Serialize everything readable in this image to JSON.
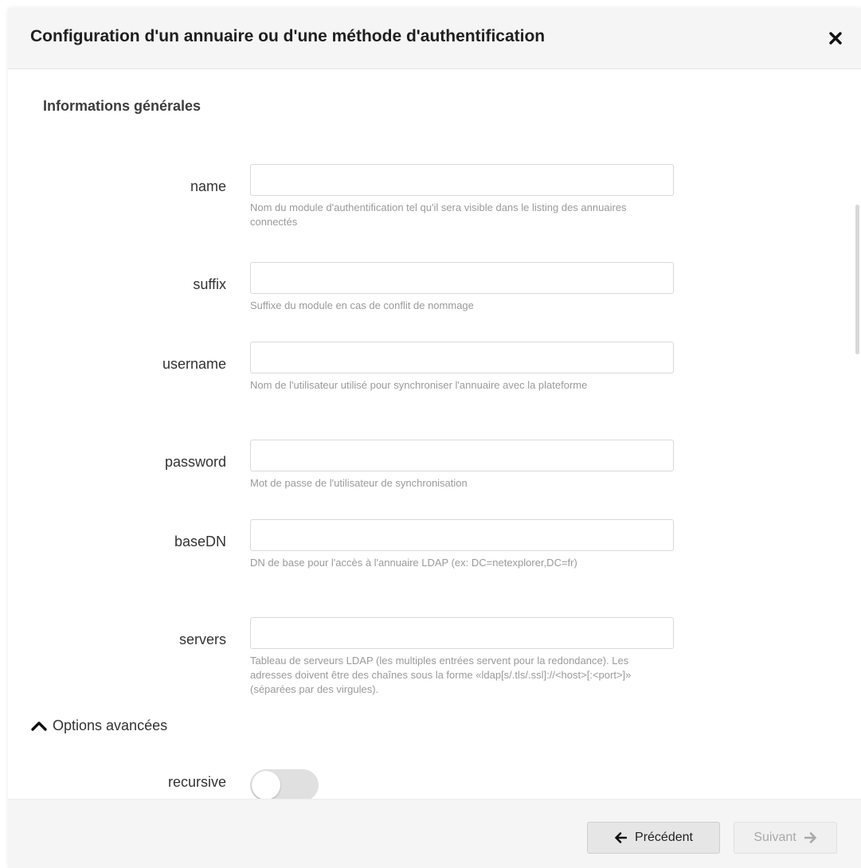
{
  "modal": {
    "title": "Configuration d'un annuaire ou d'une méthode d'authentification"
  },
  "section": {
    "title": "Informations générales"
  },
  "fields": [
    {
      "label": "name",
      "value": "",
      "help": "Nom du module d'authentification tel qu'il sera visible dans le listing des annuaires connectés"
    },
    {
      "label": "suffix",
      "value": "",
      "help": "Suffixe du module en cas de conflit de nommage"
    },
    {
      "label": "username",
      "value": "",
      "help": "Nom de l'utilisateur utilisé pour synchroniser l'annuaire avec la plateforme"
    },
    {
      "label": "password",
      "value": "",
      "help": "Mot de passe de l'utilisateur de synchronisation"
    },
    {
      "label": "baseDN",
      "value": "",
      "help": "DN de base pour l'accès à l'annuaire LDAP (ex: DC=netexplorer,DC=fr)"
    },
    {
      "label": "servers",
      "value": "",
      "help": "Tableau de serveurs LDAP (les multiples entrées servent pour la redondance). Les adresses doivent être des chaînes sous la forme «ldap[s/.tls/.ssl]://<host>[:<port>]» (séparées par des virgules)."
    }
  ],
  "advanced": {
    "label": "Options avancées",
    "expanded": true,
    "recursive": {
      "label": "recursive",
      "enabled": false
    }
  },
  "footer": {
    "prev_label": "Précédent",
    "next_label": "Suivant"
  },
  "icons": {
    "close": "close-icon",
    "chevron": "chevron-up-icon",
    "prev": "arrow-left-icon",
    "next": "arrow-right-icon"
  },
  "colors": {
    "header_bg": "#f5f5f5",
    "toggle_off": "#e0e0e0",
    "help_text": "#9a9a9a"
  }
}
